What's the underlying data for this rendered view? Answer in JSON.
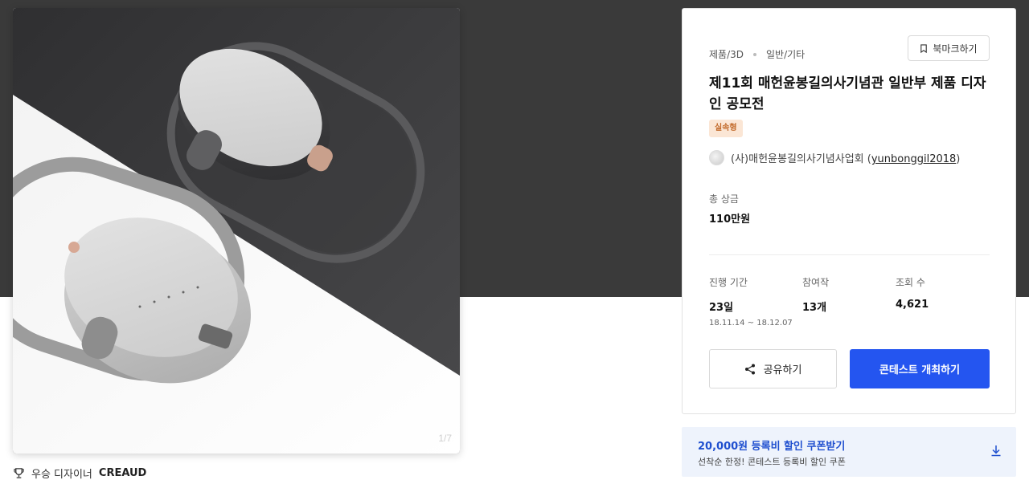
{
  "gallery": {
    "page_counter": "1/7",
    "image_alt": "power bank product render"
  },
  "winner": {
    "prefix": "우승 디자이너",
    "name": "CREAUD"
  },
  "contest": {
    "category": "제품/3D",
    "subcategory": "일반/기타",
    "bookmark_label": "북마크하기",
    "title": "제11회 매헌윤봉길의사기념관 일반부 제품 디자인 공모전",
    "badge": "실속형",
    "host_name": "(사)매헌윤봉길의사기념사업회",
    "host_handle": "yunbonggil2018",
    "prize_label": "총 상금",
    "prize_value": "110만원",
    "stats": [
      {
        "label": "진행 기간",
        "value": "23일",
        "sub": "18.11.14 ~ 18.12.07"
      },
      {
        "label": "참여작",
        "value": "13개"
      },
      {
        "label": "조회 수",
        "value": "4,621"
      }
    ],
    "share_label": "공유하기",
    "host_contest_label": "콘테스트 개최하기"
  },
  "coupon": {
    "title": "20,000원 등록비 할인 쿠폰받기",
    "subtitle": "선착순 한정! 콘테스트 등록비 할인 쿠폰"
  },
  "colors": {
    "primary": "#2455f0",
    "coupon_bg": "#eef3fc",
    "badge_bg": "#fbe6d5",
    "badge_text": "#c26a2b",
    "header_bg": "#3a3a3a"
  },
  "icons": {
    "bookmark": "bookmark-icon",
    "share": "share-icon",
    "download": "download-icon",
    "trophy": "trophy-icon"
  }
}
